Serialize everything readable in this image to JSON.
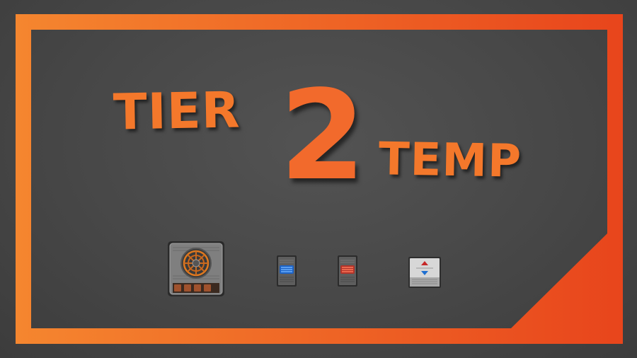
{
  "banner": {
    "word_left": "TIER",
    "number": "2",
    "word_right": "TEMP"
  },
  "colors": {
    "accent_start": "#f5862f",
    "accent_end": "#e8451c",
    "background": "#4a4a4a",
    "text": "#f4782b"
  },
  "items": [
    {
      "name": "heater-icon"
    },
    {
      "name": "cooler-icon"
    },
    {
      "name": "heat-module-icon"
    },
    {
      "name": "thermostat-icon"
    }
  ]
}
